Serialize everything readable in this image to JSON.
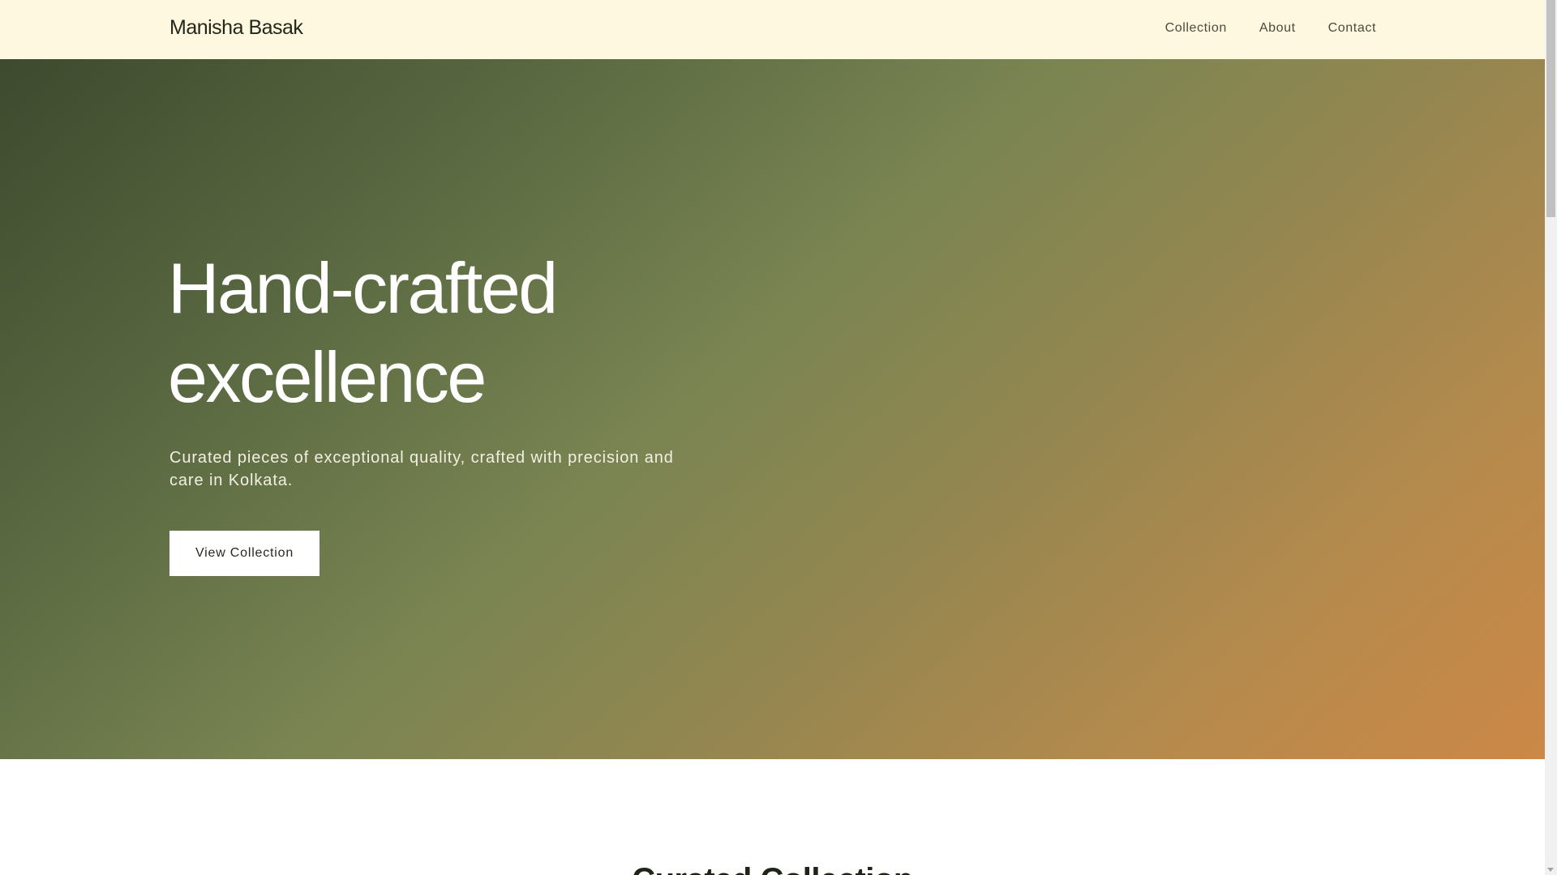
{
  "header": {
    "brand": "Manisha Basak",
    "nav": {
      "collection": "Collection",
      "about": "About",
      "contact": "Contact"
    }
  },
  "hero": {
    "title_line1": "Hand-crafted",
    "title_line2": "excellence",
    "subtitle": "Curated pieces of exceptional quality, crafted with precision and care in Kolkata.",
    "cta_label": "View Collection",
    "gradient_colors": [
      "#3d4a2e",
      "#7a8552",
      "#cc8846"
    ]
  },
  "collection_section": {
    "title": "Curated Collection"
  },
  "colors": {
    "header_bg": "#fef8e0",
    "button_bg": "#ffffff",
    "text_dark": "#22271a"
  }
}
